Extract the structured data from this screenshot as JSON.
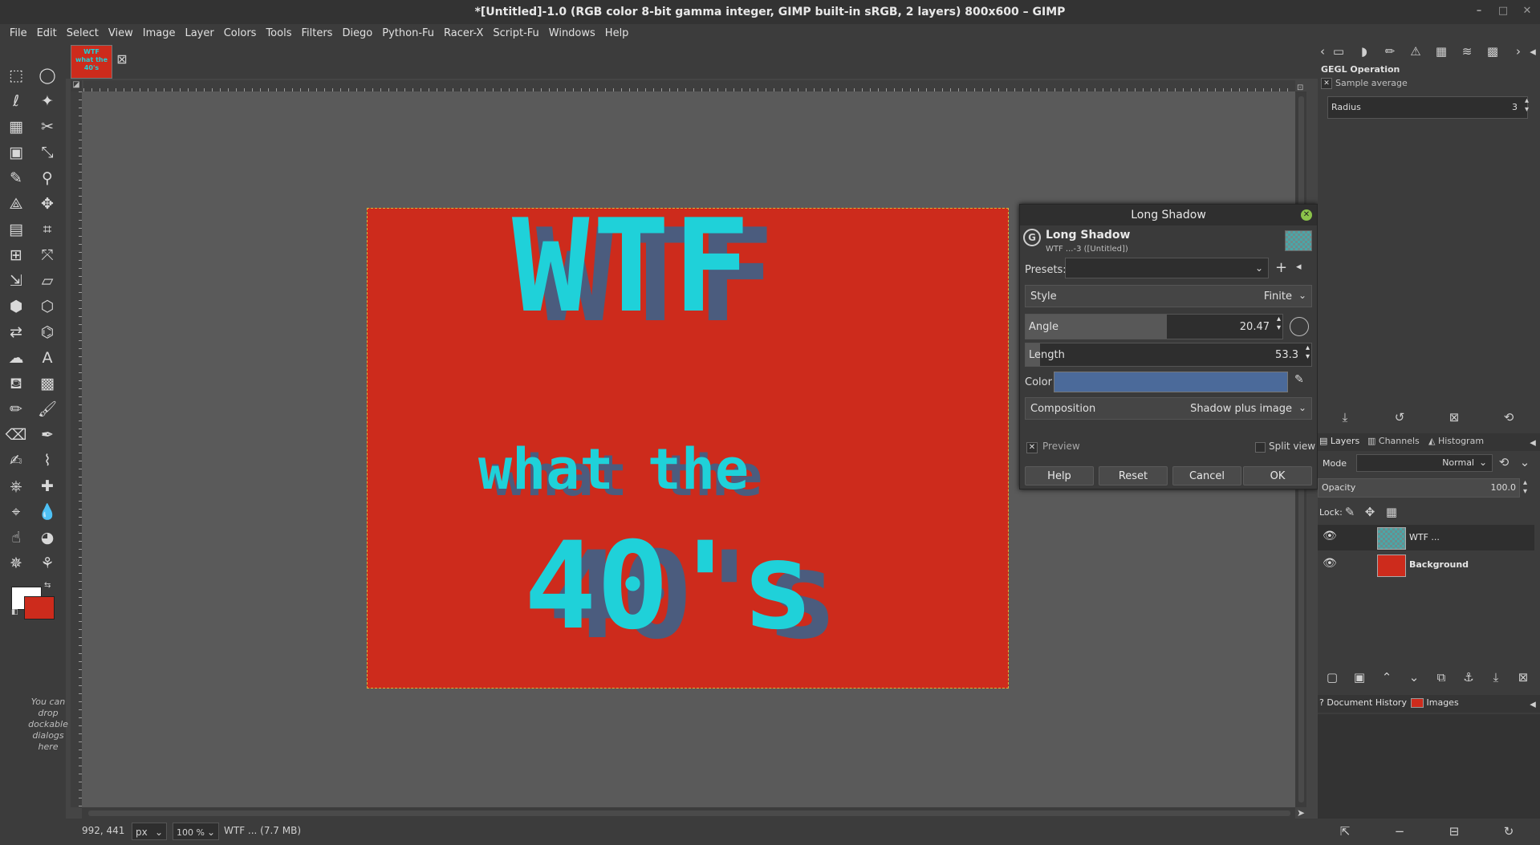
{
  "window": {
    "title": "*[Untitled]-1.0 (RGB color 8-bit gamma integer, GIMP built-in sRGB, 2 layers) 800x600 – GIMP"
  },
  "menu": [
    "File",
    "Edit",
    "Select",
    "View",
    "Image",
    "Layer",
    "Colors",
    "Tools",
    "Filters",
    "Diego",
    "Python-Fu",
    "Racer-X",
    "Script-Fu",
    "Windows",
    "Help"
  ],
  "toolbox": {
    "dock_hint": "You can drop dockable dialogs here",
    "foreground_color": "#ffffff",
    "background_color": "#cd2b1c"
  },
  "image_tab": {
    "thumb_text_1": "WTF",
    "thumb_text_2": "what the",
    "thumb_text_3": "40's"
  },
  "canvas": {
    "line1": "WTF",
    "line2": "what the",
    "line3": "40's",
    "bg_color": "#cd2b1c",
    "text_color": "#1fd1d9",
    "shadow_color": "#4b5c7e"
  },
  "statusbar": {
    "coords": "992, 441",
    "unit": "px",
    "zoom": "100 %",
    "info": "WTF ... (7.7 MB)"
  },
  "dialog": {
    "title": "Long Shadow",
    "header_name": "Long Shadow",
    "header_sub": "WTF ...-3 ([Untitled])",
    "presets_label": "Presets:",
    "presets_value": "",
    "style_label": "Style",
    "style_value": "Finite",
    "angle_label": "Angle",
    "angle_value": "20.47",
    "angle_fill": 0.55,
    "length_label": "Length",
    "length_value": "53.3",
    "length_fill": 0.05,
    "color_label": "Color",
    "color_value": "#4b6a9a",
    "composition_label": "Composition",
    "composition_value": "Shadow plus image",
    "preview_label": "Preview",
    "split_label": "Split view",
    "buttons": {
      "help": "Help",
      "reset": "Reset",
      "cancel": "Cancel",
      "ok": "OK"
    }
  },
  "gegl": {
    "title": "GEGL Operation",
    "op": "Sample average",
    "radius_label": "Radius",
    "radius_value": "3"
  },
  "layers_panel": {
    "tabs": [
      "Layers",
      "Channels",
      "Histogram"
    ],
    "mode_label": "Mode",
    "mode_value": "Normal",
    "opacity_label": "Opacity",
    "opacity_value": "100.0",
    "lock_label": "Lock:",
    "layers": [
      {
        "name": "WTF ..."
      },
      {
        "name": "Background"
      }
    ]
  },
  "bottom_panel": {
    "tabs": [
      "Document History",
      "Images"
    ]
  }
}
